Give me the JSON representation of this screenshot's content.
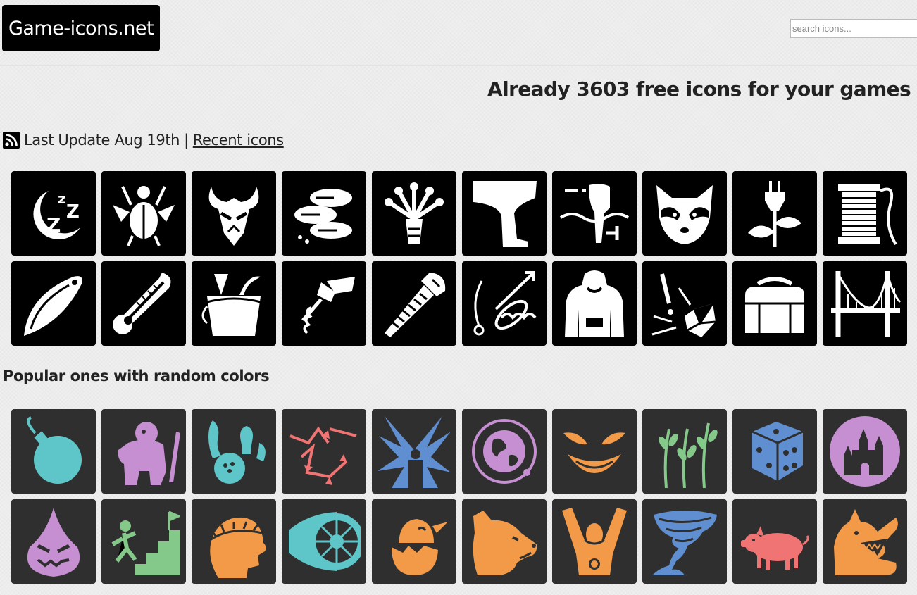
{
  "header": {
    "logo_text": "Game-icons.net",
    "search_placeholder": "search icons..."
  },
  "tagline": "Already 3603 free icons for your games",
  "update": {
    "text": "Last Update Aug 19th",
    "separator": "|",
    "link_label": "Recent icons"
  },
  "recent_icons": [
    {
      "name": "sleepy-icon",
      "glyph": "moon"
    },
    {
      "name": "scarab-beetle-icon",
      "glyph": "beetle"
    },
    {
      "name": "horned-mask-icon",
      "glyph": "mask"
    },
    {
      "name": "sushis-icon",
      "glyph": "sushi"
    },
    {
      "name": "wheat-sheaf-icon",
      "glyph": "wheat"
    },
    {
      "name": "leg-icon",
      "glyph": "leg"
    },
    {
      "name": "outboard-motor-icon",
      "glyph": "motor"
    },
    {
      "name": "raccoon-head-icon",
      "glyph": "raccoon"
    },
    {
      "name": "power-plug-sprout-icon",
      "glyph": "plug"
    },
    {
      "name": "thread-spool-icon",
      "glyph": "spool"
    },
    {
      "name": "fishing-lure-icon",
      "glyph": "lure"
    },
    {
      "name": "thermometer-icon",
      "glyph": "thermo"
    },
    {
      "name": "fish-bucket-icon",
      "glyph": "bucket"
    },
    {
      "name": "corkscrew-icon",
      "glyph": "cork"
    },
    {
      "name": "screw-icon",
      "glyph": "screw"
    },
    {
      "name": "spring-tool-icon",
      "glyph": "spring"
    },
    {
      "name": "hoodie-icon",
      "glyph": "hoodie"
    },
    {
      "name": "shattered-crystal-icon",
      "glyph": "crystal"
    },
    {
      "name": "duffel-bag-icon",
      "glyph": "bag"
    },
    {
      "name": "suspension-bridge-icon",
      "glyph": "bridge"
    }
  ],
  "popular_title": "Popular ones with random colors",
  "popular_icons": [
    {
      "name": "bomb-icon",
      "glyph": "bomb",
      "color": "#5ec6c9"
    },
    {
      "name": "troll-icon",
      "glyph": "troll",
      "color": "#c58fd1"
    },
    {
      "name": "bowling-strike-icon",
      "glyph": "bowling",
      "color": "#5ec6c9"
    },
    {
      "name": "arrow-paths-icon",
      "glyph": "arrows",
      "color": "#f07473"
    },
    {
      "name": "person-burst-icon",
      "glyph": "burst",
      "color": "#5f8fd1"
    },
    {
      "name": "earth-orbit-icon",
      "glyph": "earth",
      "color": "#c58fd1"
    },
    {
      "name": "grinning-face-icon",
      "glyph": "grin",
      "color": "#f39a48"
    },
    {
      "name": "wheat-stalks-icon",
      "glyph": "stalks",
      "color": "#84c88a"
    },
    {
      "name": "dice-icon",
      "glyph": "dice",
      "color": "#5f8fd1"
    },
    {
      "name": "castle-icon",
      "glyph": "castle",
      "color": "#c58fd1"
    },
    {
      "name": "evil-drop-icon",
      "glyph": "drop",
      "color": "#c58fd1"
    },
    {
      "name": "stairs-goal-icon",
      "glyph": "stairs",
      "color": "#84c88a"
    },
    {
      "name": "laurel-crown-icon",
      "glyph": "laurel",
      "color": "#f39a48"
    },
    {
      "name": "jet-engine-icon",
      "glyph": "engine",
      "color": "#5ec6c9"
    },
    {
      "name": "hatching-chick-icon",
      "glyph": "chick",
      "color": "#f39a48"
    },
    {
      "name": "bear-head-icon",
      "glyph": "bear",
      "color": "#f39a48"
    },
    {
      "name": "champion-icon",
      "glyph": "champion",
      "color": "#f39a48"
    },
    {
      "name": "tornado-icon",
      "glyph": "tornado",
      "color": "#5f8fd1"
    },
    {
      "name": "pig-icon",
      "glyph": "pig",
      "color": "#f07473"
    },
    {
      "name": "werewolf-icon",
      "glyph": "wolf",
      "color": "#f39a48"
    }
  ]
}
